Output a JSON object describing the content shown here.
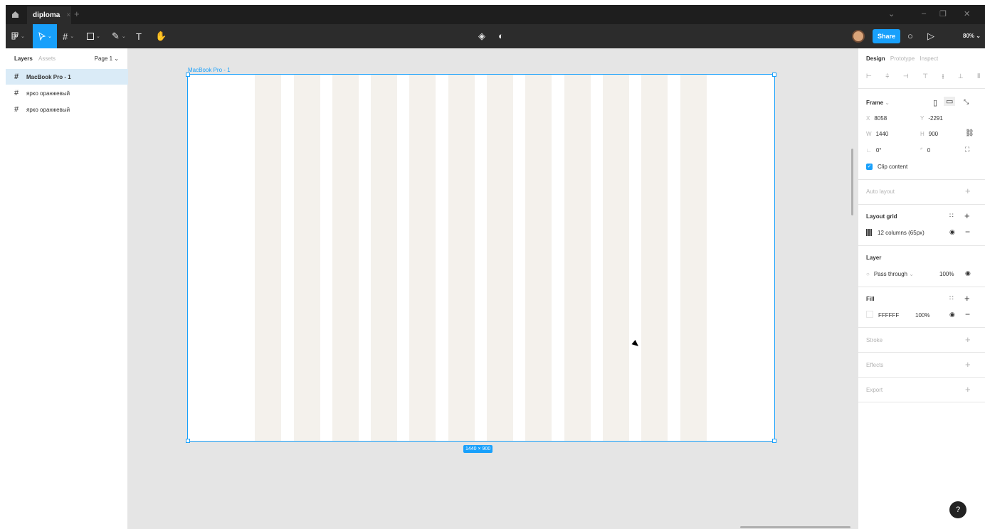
{
  "titlebar": {
    "tab_label": "diploma",
    "tab_close": "×",
    "new_tab": "+",
    "window_controls": [
      "⌄",
      "–",
      "❐",
      "✕"
    ]
  },
  "toolbar": {
    "share_label": "Share",
    "zoom_label": "80%",
    "zoom_chevron": "⌄"
  },
  "left_panel": {
    "tab_layers": "Layers",
    "tab_assets": "Assets",
    "page_selector": "Page 1 ⌄",
    "layers": [
      {
        "name": "MacBook Pro - 1",
        "selected": true
      },
      {
        "name": "ярко оранжевый",
        "selected": false
      },
      {
        "name": "ярко оранжевый",
        "selected": false
      }
    ]
  },
  "canvas": {
    "frame_label": "MacBook Pro - 1",
    "size_badge": "1440 × 900",
    "grid_column_color": "#f4f1ec"
  },
  "right_panel": {
    "tab_design": "Design",
    "tab_prototype": "Prototype",
    "tab_inspect": "Inspect",
    "frame": {
      "title": "Frame",
      "x_label": "X",
      "x_value": "8058",
      "y_label": "Y",
      "y_value": "-2291",
      "w_label": "W",
      "w_value": "1440",
      "h_label": "H",
      "h_value": "900",
      "rotation_value": "0°",
      "radius_value": "0",
      "clip_content_label": "Clip content"
    },
    "auto_layout_title": "Auto layout",
    "layout_grid": {
      "title": "Layout grid",
      "grid_label": "12 columns (65px)"
    },
    "layer": {
      "title": "Layer",
      "blend_mode": "Pass through",
      "opacity": "100%"
    },
    "fill": {
      "title": "Fill",
      "hex": "FFFFFF",
      "opacity": "100%"
    },
    "stroke_title": "Stroke",
    "effects_title": "Effects",
    "export_title": "Export",
    "help_label": "?"
  },
  "colors": {
    "accent": "#18a0fb",
    "toolbar_bg": "#2c2c2c",
    "canvas_bg": "#e5e5e5"
  }
}
